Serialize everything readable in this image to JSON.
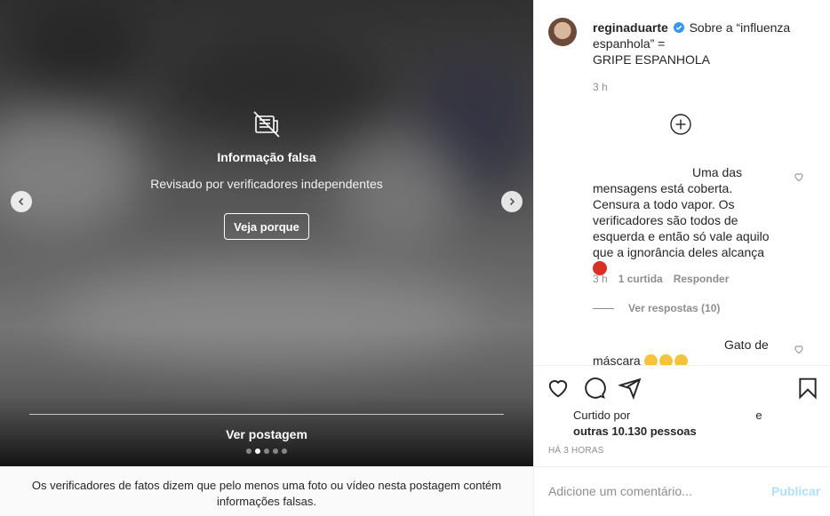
{
  "media": {
    "overlay_title": "Informação falsa",
    "overlay_subtitle": "Revisado por verificadores independentes",
    "overlay_button": "Veja porque",
    "see_post_label": "Ver postagem",
    "carousel_dots": 5,
    "active_dot": 2,
    "notice": "Os verificadores de fatos dizem que pelo menos uma foto ou vídeo nesta postagem contém informações falsas."
  },
  "post": {
    "username": "reginaduarte",
    "caption_line1": "Sobre a “influenza espanhola” =",
    "caption_line2": "GRIPE ESPANHOLA",
    "caption_time": "3 h"
  },
  "comments": [
    {
      "text": "Uma das mensagens está coberta. Censura a todo vapor. Os verificadores são todos de esquerda e então só vale aquilo que a ignorância deles alcança",
      "time": "3 h",
      "likes": "1 curtida",
      "reply_label": "Responder",
      "view_replies": "Ver respostas (10)"
    },
    {
      "text": "Gato de máscara"
    }
  ],
  "actions": {
    "liked_by_prefix": "Curtido por",
    "liked_by_and": "e",
    "others": "outras 10.130 pessoas",
    "timestamp": "HÁ 3 HORAS"
  },
  "comment_box": {
    "placeholder": "Adicione um comentário...",
    "post_label": "Publicar"
  },
  "colors": {
    "verified_badge": "#3897f0",
    "publish_disabled": "#b2dffc",
    "muted_text": "#8e8e8e"
  }
}
